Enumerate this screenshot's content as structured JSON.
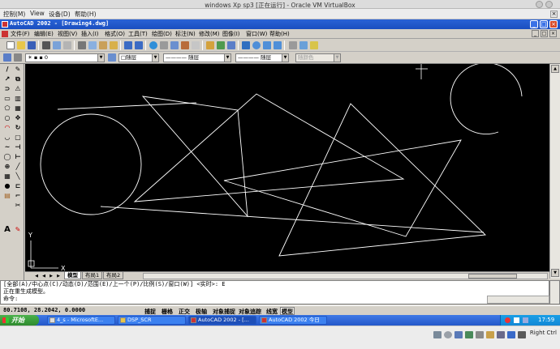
{
  "vbox": {
    "title": "windows Xp sp3 [正在运行] - Oracle VM VirtualBox",
    "menu": [
      "控制(M)",
      "View",
      "设备(D)",
      "帮助(H)"
    ],
    "close_glyph": "×",
    "host_key": "Right Ctrl"
  },
  "acad": {
    "title": "AutoCAD 2002 - [Drawing4.dwg]",
    "window_buttons": [
      "_",
      "□",
      "×"
    ],
    "menu": [
      "文件(F)",
      "编辑(E)",
      "视图(V)",
      "插入(I)",
      "格式(O)",
      "工具(T)",
      "绘图(D)",
      "标注(N)",
      "修改(M)",
      "图像(I)",
      "窗口(W)",
      "帮助(H)"
    ],
    "doc_buttons": [
      "_",
      "□",
      "×"
    ],
    "layer_value": "0",
    "color_value": "□随层",
    "linetype_value": "———— 随层",
    "lineweight_value": "———— 随层",
    "plotstyle_value": "随颜色",
    "dropdown_glyph": "▼"
  },
  "layout_tabs": [
    "模型",
    "布局1",
    "布局2"
  ],
  "tab_nav_glyphs": [
    "◀",
    "◀",
    "▶",
    "▶"
  ],
  "command": {
    "line1": "[全部(A)/中心点(C)/动态(D)/范围(E)/上一个(P)/比例(S)/窗口(W)] <实时>:  E",
    "line2": "正在重生成模型。",
    "line3": "命令:"
  },
  "status": {
    "coords": "80.7108, 28.2042, 0.0000",
    "modes": [
      "捕捉",
      "栅格",
      "正交",
      "极轴",
      "对象捕捉",
      "对象追踪",
      "线宽",
      "模型"
    ],
    "modes_on": [
      false,
      false,
      false,
      false,
      false,
      false,
      false,
      true
    ]
  },
  "taskbar": {
    "start": "开始",
    "tasks": [
      "4_s - MicrosoftE...",
      "DSP_SCR",
      "AutoCAD 2002 - [...",
      "AutoCAD 2002 今日"
    ],
    "active_task": 2,
    "clock": "17:59"
  },
  "ucs": {
    "x": "X",
    "y": "Y"
  },
  "left_tools_a": [
    "/",
    "↗",
    "⊃",
    "▭",
    "⬠",
    "○",
    "◠",
    "◡",
    "~",
    "◯",
    "⊕",
    "▦",
    "●",
    "▤",
    "A"
  ],
  "left_tools_b": [
    "✎",
    "⧉",
    "⚠",
    "▥",
    "▦",
    "✥",
    "↻",
    "▢",
    "⊣",
    "⊢",
    "╱",
    "╲",
    "⊏",
    "⌐",
    "✂",
    "✎"
  ],
  "colors": {
    "canvas": "#000000",
    "lines": "#ffffff",
    "title_bar": "#1a4ec0",
    "taskbar": "#2457c9",
    "start": "#2e8a2e"
  }
}
